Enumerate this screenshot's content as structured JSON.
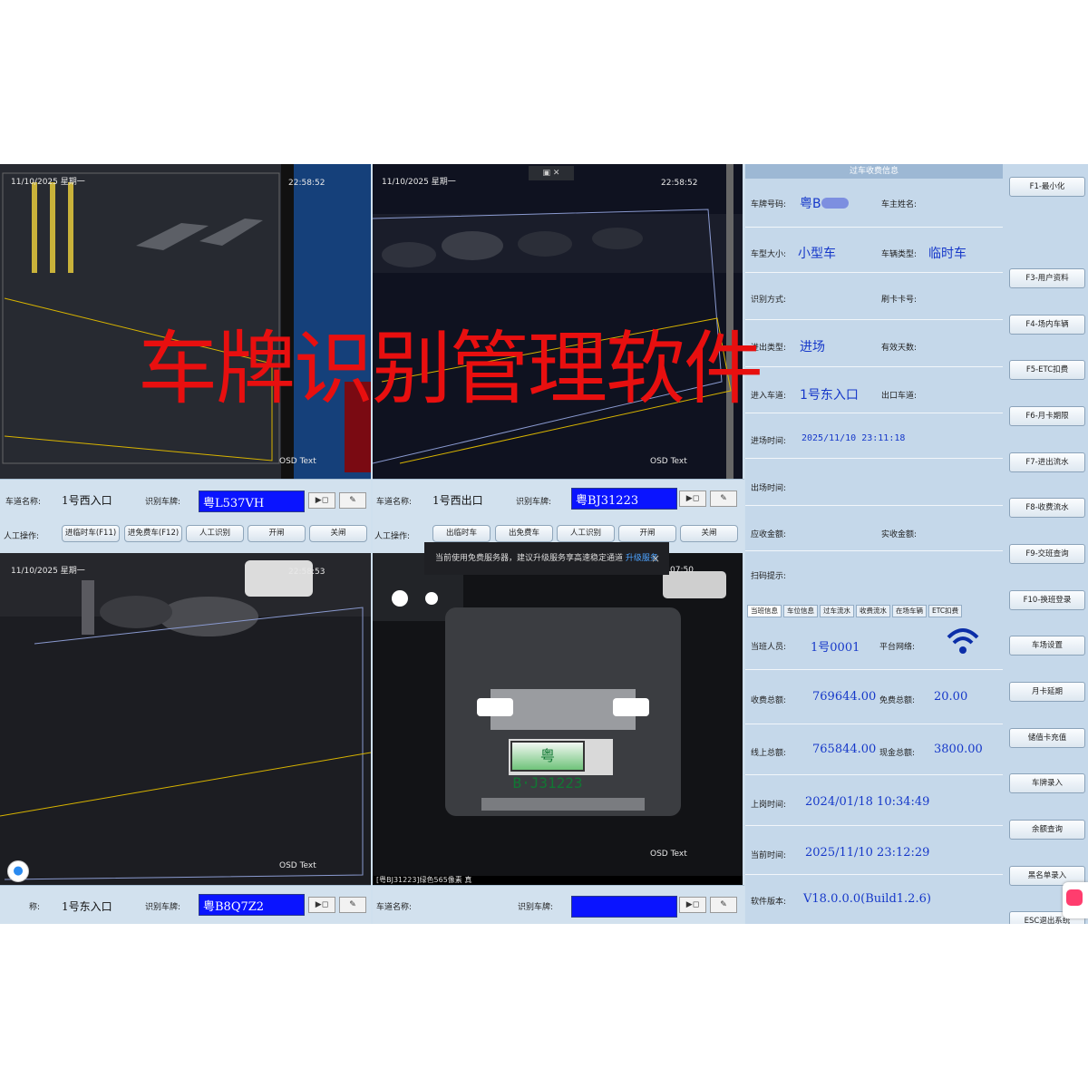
{
  "watermark": "车牌识别管理软件",
  "cams": [
    {
      "timestamp": "11/10/2025 星期一",
      "time": "22:58:52",
      "osd": "OSD Text"
    },
    {
      "timestamp": "11/10/2025 星期一",
      "time": "22:58:52",
      "osd": "OSD Text"
    },
    {
      "timestamp": "11/10/2025 星期一",
      "time": "22:58:53",
      "osd": "OSD Text"
    },
    {
      "time": "07:50",
      "osd": "OSD Text",
      "caption": "[粤BJ31223]绿色565像素 真",
      "plate": "粤B·J31223"
    }
  ],
  "lanes": [
    {
      "lane_label": "车道名称:",
      "lane": "1号西入口",
      "plate_label": "识别车牌:",
      "plate": "粤L537VH"
    },
    {
      "lane_label": "车道名称:",
      "lane": "1号西出口",
      "plate_label": "识别车牌:",
      "plate": "粤BJ31223"
    },
    {
      "lane_label": "称:",
      "lane": "1号东入口",
      "plate_label": "识别车牌:",
      "plate": "粤B8Q7Z2"
    },
    {
      "lane_label": "车道名称:",
      "lane": "",
      "plate_label": "识别车牌:",
      "plate": ""
    }
  ],
  "manual_label": "人工操作:",
  "btns_left": [
    "进临时车(F11)",
    "进免费车(F12)",
    "人工识别",
    "开闸",
    "关闸"
  ],
  "btns_right": [
    "出临时车",
    "出免费车",
    "人工识别",
    "开闸",
    "关闸"
  ],
  "popup": {
    "text": "当前使用免费服务器，建议升级服务享高速稳定通道",
    "link": "升级服务",
    "close": "×"
  },
  "info": {
    "header": "过车收费信息",
    "plate_label": "车牌号码:",
    "plate": "粤B",
    "owner_label": "车主姓名:",
    "size_label": "车型大小:",
    "size": "小型车",
    "vtype_label": "车辆类型:",
    "vtype": "临时车",
    "rec_label": "识别方式:",
    "card_label": "刷卡卡号:",
    "io_label": "进出类型:",
    "io": "进场",
    "days_label": "有效天数:",
    "in_lane_label": "进入车道:",
    "in_lane": "1号东入口",
    "out_lane_label": "出口车道:",
    "in_time_label": "进场时间:",
    "in_time": "2025/11/10 23:11:18",
    "out_time_label": "出场时间:",
    "due_label": "应收金额:",
    "paid_label": "实收金额:",
    "scan_label": "扫码提示:"
  },
  "tabs": [
    "当班信息",
    "车位信息",
    "过车流水",
    "收费流水",
    "在场车辆",
    "ETC扣费"
  ],
  "shift": {
    "staff_label": "当班人员:",
    "staff": "1号0001",
    "net_label": "平台网络:",
    "fee_label": "收费总额:",
    "fee": "769644.00",
    "free_label": "免费总额:",
    "free": "20.00",
    "online_label": "线上总额:",
    "online": "765844.00",
    "cash_label": "现金总额:",
    "cash": "3800.00",
    "shift_time_label": "上岗时间:",
    "shift_time": "2024/01/18 10:34:49",
    "now_label": "当前时间:",
    "now": "2025/11/10 23:12:29",
    "ver_label": "软件版本:",
    "ver": "V18.0.0.0(Build1.2.6)"
  },
  "side": [
    "F1-最小化",
    "F3-用户资料",
    "F4-场内车辆",
    "F5-ETC扣费",
    "F6-月卡期限",
    "F7-进出流水",
    "F8-收费流水",
    "F9-交班查询",
    "F10-换班登录",
    "车场设置",
    "月卡延期",
    "储值卡充值",
    "车牌录入",
    "余额查询",
    "黑名单录入",
    "ESC退出系统"
  ],
  "colors": {
    "plate_bg": "#0a14ff",
    "value": "#1638c9",
    "watermark": "#e80f0f"
  }
}
